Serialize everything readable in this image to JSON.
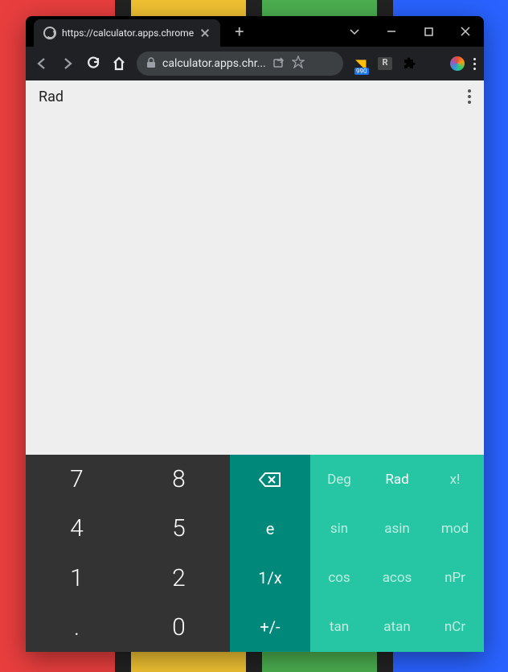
{
  "browser": {
    "tab": {
      "title": "https://calculator.apps.chrome"
    },
    "url_display": "calculator.apps.chr...",
    "extension_badge": "990",
    "extension_r": "R"
  },
  "calculator": {
    "mode_label": "Rad",
    "numpad": [
      "7",
      "8",
      "4",
      "5",
      "1",
      "2",
      ".",
      "0"
    ],
    "ops": [
      "",
      "e",
      "1/x",
      "+/-"
    ],
    "sci": [
      {
        "label": "Deg",
        "active": false
      },
      {
        "label": "Rad",
        "active": true
      },
      {
        "label": "x!",
        "active": false
      },
      {
        "label": "sin",
        "active": false
      },
      {
        "label": "asin",
        "active": false
      },
      {
        "label": "mod",
        "active": false
      },
      {
        "label": "cos",
        "active": false
      },
      {
        "label": "acos",
        "active": false
      },
      {
        "label": "nPr",
        "active": false
      },
      {
        "label": "tan",
        "active": false
      },
      {
        "label": "atan",
        "active": false
      },
      {
        "label": "nCr",
        "active": false
      }
    ]
  }
}
